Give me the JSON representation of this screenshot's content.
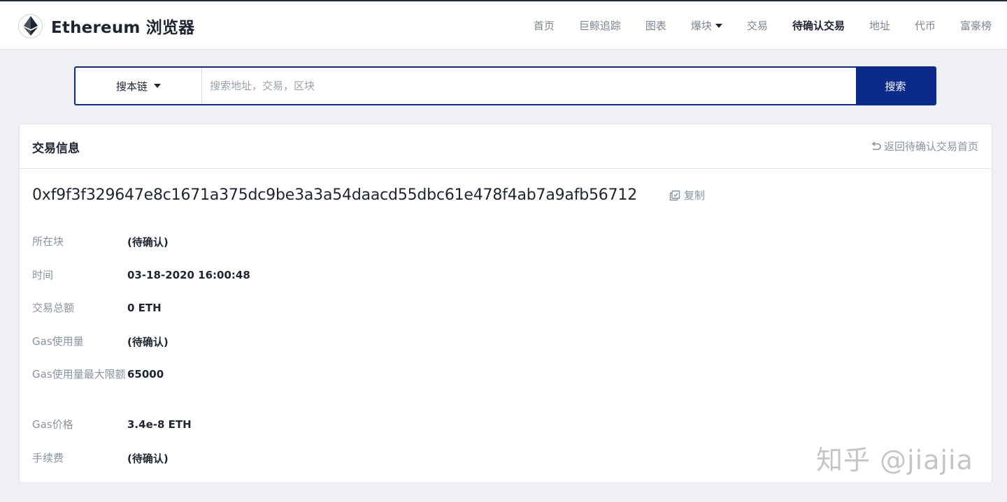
{
  "header": {
    "brand_title": "Ethereum 浏览器",
    "logo_icon": "ethereum-diamond-icon",
    "nav": [
      {
        "label": "首页",
        "active": false
      },
      {
        "label": "巨鲸追踪",
        "active": false
      },
      {
        "label": "图表",
        "active": false
      },
      {
        "label": "爆块",
        "active": false,
        "dropdown": true
      },
      {
        "label": "交易",
        "active": false
      },
      {
        "label": "待确认交易",
        "active": true
      },
      {
        "label": "地址",
        "active": false
      },
      {
        "label": "代币",
        "active": false
      },
      {
        "label": "富豪榜",
        "active": false
      }
    ]
  },
  "search": {
    "scope_label": "搜本链",
    "placeholder": "搜索地址，交易，区块",
    "button_label": "搜索"
  },
  "card": {
    "title": "交易信息",
    "back_label": "返回待确认交易首页",
    "hash": "0xf9f3f329647e8c1671a375dc9be3a3a54daacd55dbc61e478f4ab7a9afb56712",
    "copy_label": "复制",
    "rows": [
      {
        "label": "所在块",
        "value": "(待确认)"
      },
      {
        "label": "时间",
        "value": "03-18-2020 16:00:48"
      },
      {
        "label": "交易总额",
        "value": "0 ETH"
      },
      {
        "label": "Gas使用量",
        "value": "(待确认)"
      },
      {
        "label": "Gas使用量最大限额",
        "value": "65000"
      },
      {
        "label": "Gas价格",
        "value": "3.4e-8 ETH"
      },
      {
        "label": "手续费",
        "value": "(待确认)"
      }
    ]
  },
  "watermark": "知乎 @jiajia",
  "colors": {
    "primary": "#0b2a8a",
    "page_bg": "#eef0f3",
    "muted_text": "#8a929d"
  }
}
